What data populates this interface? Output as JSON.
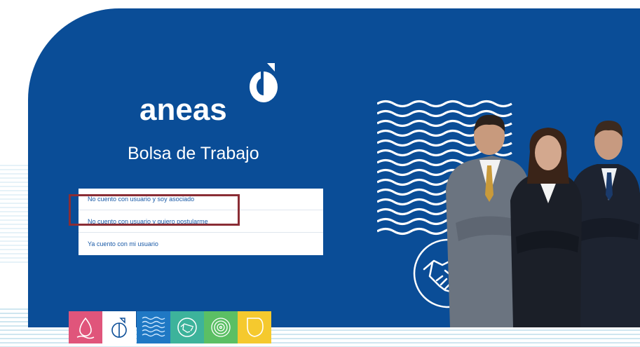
{
  "brand": {
    "name": "aneas"
  },
  "page": {
    "subtitle": "Bolsa de Trabajo"
  },
  "menu": {
    "items": [
      {
        "label": "No cuento con usuario y soy asociado"
      },
      {
        "label": "No cuento con usuario y quiero postularme"
      },
      {
        "label": "Ya cuento con mi usuario"
      }
    ]
  },
  "tiles": [
    {
      "icon": "water-drop-icon",
      "color": "#e0557b"
    },
    {
      "icon": "aneas-outline-icon",
      "color": "#ffffff"
    },
    {
      "icon": "waves-icon",
      "color": "#1f78c4"
    },
    {
      "icon": "handshake-icon",
      "color": "#3db39b"
    },
    {
      "icon": "target-icon",
      "color": "#5bbf64"
    },
    {
      "icon": "shield-icon",
      "color": "#f5c92e"
    }
  ],
  "colors": {
    "primary": "#0a4d97",
    "highlight": "#8a2d35",
    "link": "#1a5aa7"
  }
}
